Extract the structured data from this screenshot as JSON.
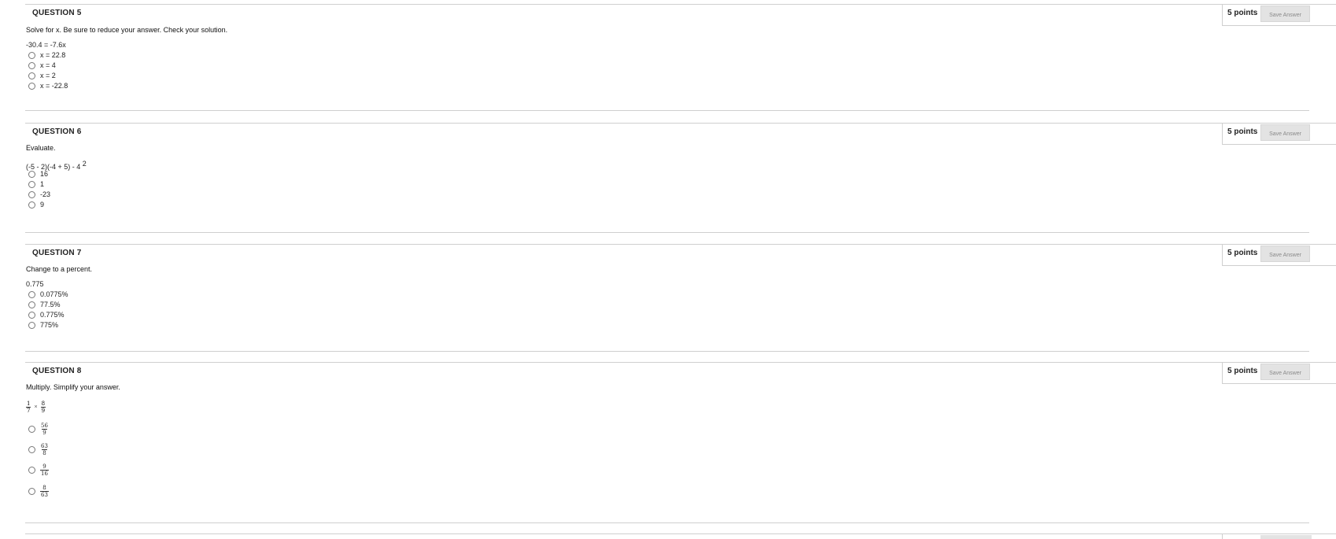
{
  "questions": [
    {
      "title": "QUESTION 5",
      "points": "5 points",
      "save_label": "Save Answer",
      "prompt": "Solve for x. Be sure to reduce your answer. Check your solution.",
      "expression": "-30.4 = -7.6x",
      "options": [
        "x = 22.8",
        "x = 4",
        "x = 2",
        "x = -22.8"
      ]
    },
    {
      "title": "QUESTION 6",
      "points": "5 points",
      "save_label": "Save Answer",
      "prompt": "Evaluate.",
      "expression": "(-5 - 2)(-4 + 5) - 4",
      "expression_exponent": "2",
      "options": [
        "16",
        "1",
        "-23",
        "9"
      ]
    },
    {
      "title": "QUESTION 7",
      "points": "5 points",
      "save_label": "Save Answer",
      "prompt": "Change to a percent.",
      "expression": "0.775",
      "options": [
        "0.0775%",
        "77.5%",
        "0.775%",
        "775%"
      ]
    },
    {
      "title": "QUESTION 8",
      "points": "5 points",
      "save_label": "Save Answer",
      "prompt": "Multiply. Simplify your answer.",
      "expression": {
        "left": {
          "num": "1",
          "den": "7"
        },
        "operator": "×",
        "right": {
          "num": "8",
          "den": "9"
        }
      },
      "options": [
        {
          "num": "56",
          "den": "9"
        },
        {
          "num": "63",
          "den": "8"
        },
        {
          "num": "9",
          "den": "16"
        },
        {
          "num": "8",
          "den": "63"
        }
      ]
    }
  ],
  "icons": {
    "radio": "radio-button-icon"
  },
  "colors": {
    "divider": "#cfcfcf",
    "save_button_bg": "#e3e3e3",
    "save_button_text": "#8a8a8a"
  }
}
